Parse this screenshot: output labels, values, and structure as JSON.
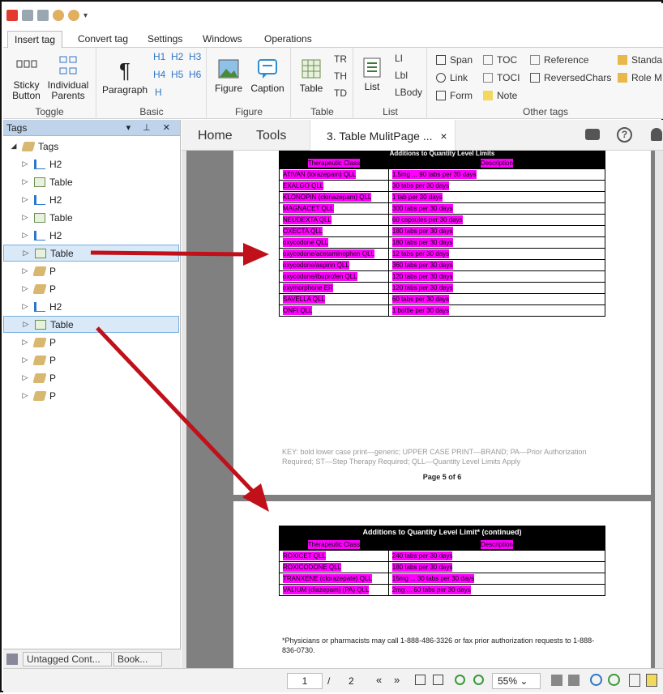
{
  "ribbon_tabs": [
    "Insert tag",
    "Convert tag",
    "Settings",
    "Windows",
    "Operations"
  ],
  "groups": {
    "toggle": "Toggle",
    "basic": "Basic",
    "figure": "Figure",
    "table": "Table",
    "list": "List",
    "other": "Other tags"
  },
  "buttons": {
    "sticky": "Sticky Button",
    "individual": "Individual Parents",
    "paragraph": "Paragraph",
    "figure": "Figure",
    "caption": "Caption",
    "table": "Table",
    "list": "List"
  },
  "headings": [
    "H1",
    "H2",
    "H3",
    "H4",
    "H5",
    "H6",
    "H"
  ],
  "table_small": [
    "TR",
    "TH",
    "TD"
  ],
  "list_small": [
    "LI",
    "Lbl",
    "LBody"
  ],
  "other_small": [
    "Span",
    "Link",
    "Form",
    "TOC",
    "TOCI",
    "Note",
    "Reference",
    "ReversedChars",
    "Standa",
    "Role M"
  ],
  "panel": {
    "title": "Tags",
    "root": "Tags",
    "items": [
      "H2",
      "Table",
      "H2",
      "Table",
      "H2",
      "Table",
      "P",
      "P",
      "H2",
      "Table",
      "P",
      "P",
      "P",
      "P"
    ]
  },
  "bottom_tabs": [
    "Untagged Cont...",
    "Book..."
  ],
  "viewer": {
    "home": "Home",
    "tools": "Tools",
    "doc_tab": "3. Table MulitPage ...",
    "close": "×"
  },
  "page1": {
    "caption": "Additions to Quantity Level Limits",
    "headers": [
      "Therapeutic Class",
      "Description"
    ],
    "rows": [
      [
        "ATIVAN (lorazepam) QLL",
        "1.5mg ... 90 tabs per 30 days"
      ],
      [
        "EXALGO QLL",
        "30 tabs per 30 days"
      ],
      [
        "KLONOPIN (clonazepam) QLL",
        "1 tab per 30 days"
      ],
      [
        "MAGNACET QLL",
        "300 tabs per 30 days"
      ],
      [
        "NEUDEXTA QLL",
        "60 capsules per 30 days"
      ],
      [
        "OXECTA QLL",
        "180 tabs per 30 days"
      ],
      [
        "oxycodone QLL",
        "180 tabs per 30 days"
      ],
      [
        "oxycodone/acetaminophen QLL",
        "12 tabs per 30 days"
      ],
      [
        "oxycodone/aspirin QLL",
        "360 tabs per 30 days"
      ],
      [
        "oxycodone/ibuprofen QLL",
        "120 tabs per 30 days"
      ],
      [
        "oxymorphone ER",
        "120 tabs per 30 days"
      ],
      [
        "SAVELLA QLL",
        "60 tabs per 30 days"
      ],
      [
        "ONFI QLL",
        "1 bottle per 30 days"
      ]
    ],
    "key": "KEY:  bold lower case print—generic; UPPER  CASE  PRINT—BRAND;  PA—Prior Authorization Required; ST—Step Therapy Required; QLL—Quantity Level Limits Apply",
    "page_num": "Page 5 of 6"
  },
  "page2": {
    "caption": "Additions to Quantity Level Limit* (continued)",
    "headers": [
      "Therapeutic Class",
      "Description"
    ],
    "rows": [
      [
        "ROXICET QLL",
        "240 tabs per 30 days"
      ],
      [
        "ROXICODONE QLL",
        "180 tabs per 30 days"
      ],
      [
        "TRANXENE (clorazepate) QLL",
        "15mg ... 30 tabs per 30 days"
      ],
      [
        "VALIUM (diazepam) (PA) QLL",
        "2mg ... 60 tabs per 30 days"
      ]
    ],
    "footnote": "*Physicians or pharmacists may call 1-888-486-3326 or fax prior authorization requests to 1-888-836-0730."
  },
  "status": {
    "page": "1",
    "sep": "/",
    "total": "2",
    "zoom": "55%"
  },
  "colors": {
    "highlight": "#ff00ff",
    "arrow": "#c0101a",
    "selected": "#d9e9f7"
  }
}
